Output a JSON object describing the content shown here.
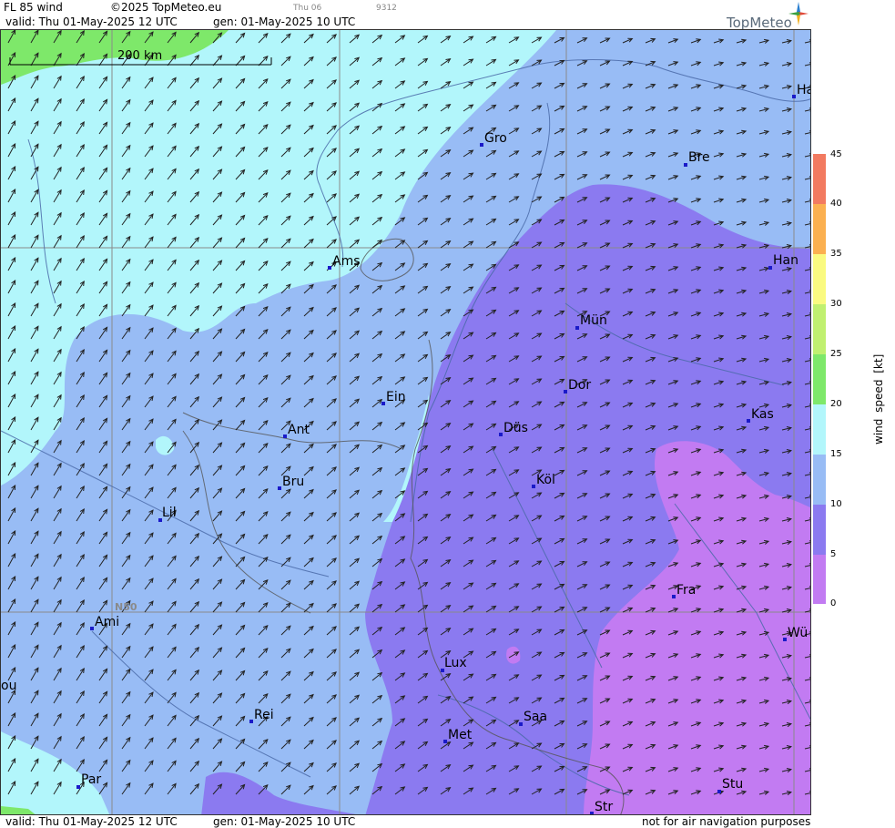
{
  "header": {
    "product": "FL 85 wind",
    "copyright": "©2025 TopMeteo.eu",
    "valid": "valid:  Thu  01-May-2025  12 UTC",
    "gen": "gen: 01-May-2025 10 UTC",
    "aux_day": "Thu 06",
    "aux_code": "9312",
    "logo": "TopMeteo"
  },
  "footer": {
    "valid": "valid:  Thu  01-May-2025  12 UTC",
    "gen": "gen: 01-May-2025 10 UTC",
    "disclaimer": "not for air navigation purposes"
  },
  "map": {
    "scale_label": "200 km",
    "lat_label": "N50",
    "cities": [
      {
        "label": "Ha"
      },
      {
        "label": "Gro"
      },
      {
        "label": "Bre"
      },
      {
        "label": "Ams"
      },
      {
        "label": "Han"
      },
      {
        "label": "Mün"
      },
      {
        "label": "Dor"
      },
      {
        "label": "Ein"
      },
      {
        "label": "Kas"
      },
      {
        "label": "Ant"
      },
      {
        "label": "Düs"
      },
      {
        "label": "Bru"
      },
      {
        "label": "Köl"
      },
      {
        "label": "Lil"
      },
      {
        "label": "Fra"
      },
      {
        "label": "Ami"
      },
      {
        "label": "Wü"
      },
      {
        "label": "Lux"
      },
      {
        "label": "Rei"
      },
      {
        "label": "Saa"
      },
      {
        "label": "Met"
      },
      {
        "label": "ou"
      },
      {
        "label": "Par"
      },
      {
        "label": "Stu"
      },
      {
        "label": "Str"
      }
    ]
  },
  "legend": {
    "title": "wind speed [kt]",
    "ticks": [
      "45",
      "40",
      "35",
      "30",
      "25",
      "20",
      "15",
      "10",
      "5",
      "0"
    ],
    "colors": {
      "0-5": "#c27bf2",
      "5-10": "#8b7af0",
      "10-15": "#98bcf5",
      "15-20": "#b2f6fb",
      "20-25": "#7ee86a",
      "25-30": "#c0f070",
      "30-35": "#fafa80",
      "35-40": "#fbb050",
      "40-45": "#f27a60"
    }
  }
}
